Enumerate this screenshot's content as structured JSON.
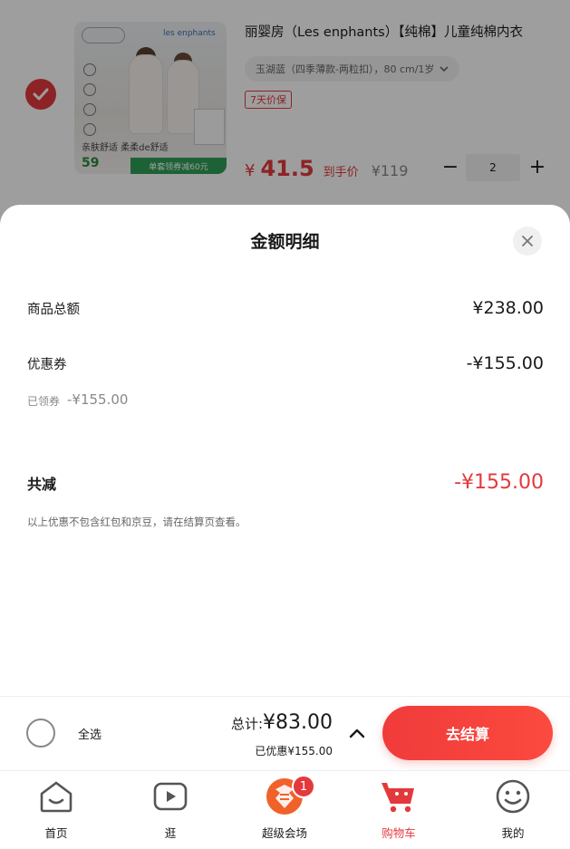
{
  "product": {
    "checked": true,
    "title": "丽婴房（Les enphants）【纯棉】儿童纯棉内衣",
    "spec": "玉湖蓝（四季薄款-两粒扣），80 cm/1岁",
    "guarantee": "7天价保",
    "price_currency": "¥",
    "price_value": "41.5",
    "price_label": "到手价",
    "original_price": "¥119",
    "quantity": "2",
    "quantity_minus": "−",
    "quantity_plus": "+",
    "image": {
      "brand": "les enphants",
      "slogan": "亲肤舒适 柔柔de舒适",
      "price": "59",
      "promo": "单套领券减60元"
    }
  },
  "sheet": {
    "title": "金额明细",
    "rows": {
      "goods_total_label": "商品总额",
      "goods_total_value": "¥238.00",
      "coupon_label": "优惠券",
      "coupon_value": "-¥155.00",
      "claimed_label": "已领券",
      "claimed_value": "-¥155.00",
      "total_reduction_label": "共减",
      "total_reduction_value": "-¥155.00",
      "note": "以上优惠不包含红包和京豆，请在结算页查看。"
    }
  },
  "checkout": {
    "select_all_label": "全选",
    "total_prefix": "总计:",
    "total_amount": "¥83.00",
    "discount_line": "已优惠¥155.00",
    "checkout_button": "去结算"
  },
  "tabs": [
    {
      "label": "首页",
      "icon": "home-icon",
      "active": false
    },
    {
      "label": "逛",
      "icon": "video-play-icon",
      "active": false
    },
    {
      "label": "超级会场",
      "icon": "super-venue-icon",
      "active": false,
      "badge": "1"
    },
    {
      "label": "购物车",
      "icon": "cart-icon",
      "active": true
    },
    {
      "label": "我的",
      "icon": "profile-face-icon",
      "active": false
    }
  ],
  "colors": {
    "accent": "#e4393c",
    "checkout_gradient_start": "#f03b3b",
    "checkout_gradient_end": "#fb4a3e",
    "muted_text": "#888888",
    "overlay": "rgba(0,0,0,0.38)"
  }
}
